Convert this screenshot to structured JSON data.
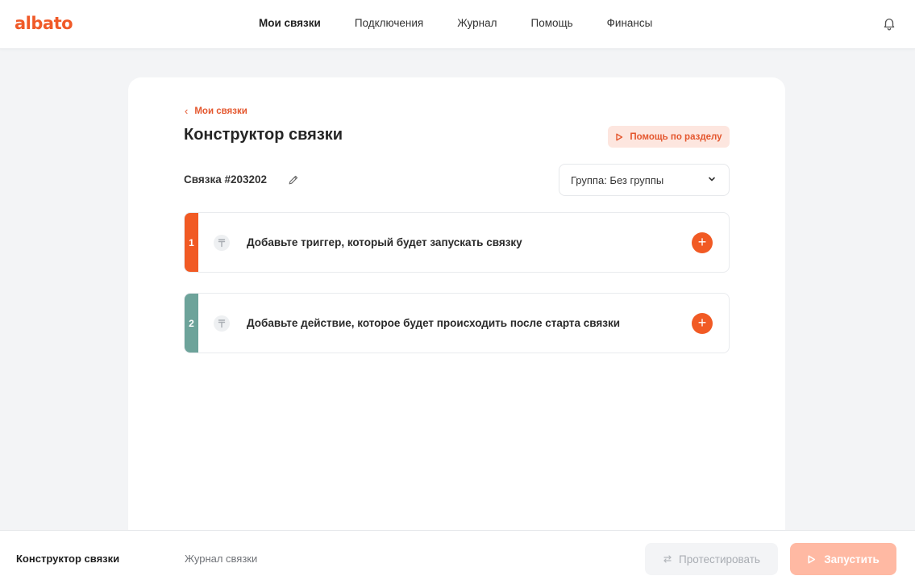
{
  "brand": {
    "logo_text": "albato",
    "accent": "#f05a28"
  },
  "nav": {
    "items": [
      {
        "label": "Мои связки",
        "active": true
      },
      {
        "label": "Подключения",
        "active": false
      },
      {
        "label": "Журнал",
        "active": false
      },
      {
        "label": "Помощь",
        "active": false
      },
      {
        "label": "Финансы",
        "active": false
      }
    ],
    "notifications_icon": "bell-icon"
  },
  "page": {
    "back_label": "Мои связки",
    "title": "Конструктор связки",
    "help_button_label": "Помощь по разделу",
    "connection_label": "Связка #203202",
    "group_select_value": "Группа: Без группы"
  },
  "steps": [
    {
      "number": "1",
      "text": "Добавьте триггер, который будет запускать связку",
      "color": "#f15a24"
    },
    {
      "number": "2",
      "text": "Добавьте действие, которое будет происходить после старта связки",
      "color": "#6da39a"
    }
  ],
  "bottom": {
    "tabs": [
      {
        "label": "Конструктор связки",
        "active": true
      },
      {
        "label": "Журнал связки",
        "active": false
      }
    ],
    "test_button_label": "Протестировать",
    "run_button_label": "Запустить"
  }
}
